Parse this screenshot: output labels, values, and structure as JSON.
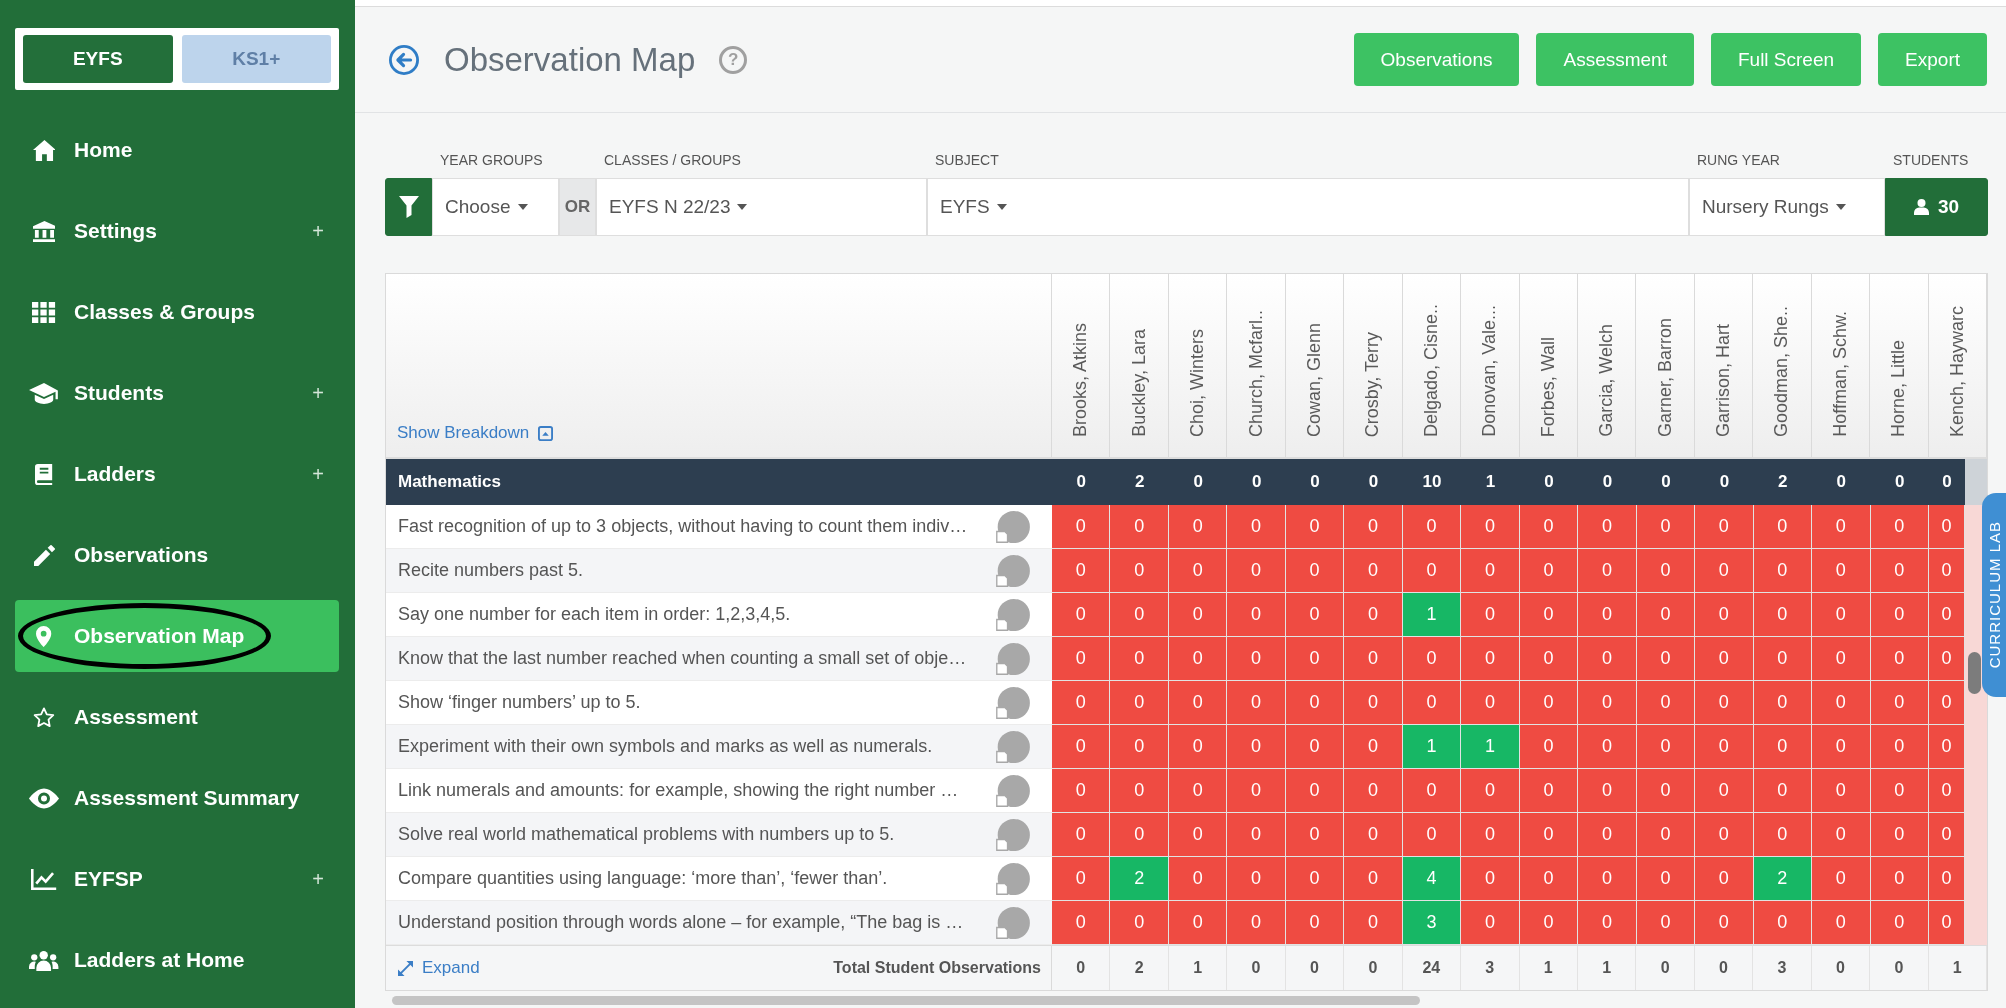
{
  "sidebar": {
    "modes": [
      {
        "label": "EYFS",
        "selected": true
      },
      {
        "label": "KS1+",
        "selected": false
      }
    ],
    "items": [
      {
        "label": "Home",
        "selected": false,
        "circled": false
      },
      {
        "label": "Settings",
        "expander": "+",
        "selected": false,
        "circled": false
      },
      {
        "label": "Classes & Groups",
        "selected": false,
        "circled": false
      },
      {
        "label": "Students",
        "expander": "+",
        "selected": false,
        "circled": false
      },
      {
        "label": "Ladders",
        "expander": "+",
        "selected": false,
        "circled": false
      },
      {
        "label": "Observations",
        "selected": false,
        "circled": false
      },
      {
        "label": "Observation Map",
        "selected": true,
        "circled": true
      },
      {
        "label": "Assessment",
        "selected": false,
        "circled": false
      },
      {
        "label": "Assessment Summary",
        "selected": false,
        "circled": false
      },
      {
        "label": "EYFSP",
        "expander": "+",
        "selected": false,
        "circled": false
      },
      {
        "label": "Ladders at Home",
        "selected": false,
        "circled": false
      }
    ]
  },
  "header": {
    "title": "Observation Map",
    "help": "?",
    "buttons": [
      "Observations",
      "Assessment",
      "Full Screen",
      "Export"
    ]
  },
  "filters": {
    "year_groups": {
      "label": "YEAR GROUPS",
      "value": "Choose"
    },
    "separator": "OR",
    "classes_groups": {
      "label": "CLASSES / GROUPS",
      "value": "EYFS N 22/23"
    },
    "subject": {
      "label": "SUBJECT",
      "value": "EYFS"
    },
    "rung_year": {
      "label": "RUNG YEAR",
      "value": "Nursery Rungs"
    },
    "students": {
      "label": "STUDENTS",
      "count": "30"
    }
  },
  "observation_map": {
    "show_breakdown": "Show Breakdown",
    "students": [
      "Brooks, Atkins",
      "Buckley, Lara",
      "Choi, Winters",
      "Church, Mcfarl..",
      "Cowan, Glenn",
      "Crosby, Terry",
      "Delgado, Cisne..",
      "Donovan, Vale...",
      "Forbes, Wall",
      "Garcia, Welch",
      "Garner, Barron",
      "Garrison, Hart",
      "Goodman, She..",
      "Hoffman, Schw.",
      "Horne, Little",
      "Kench, Haywarc"
    ],
    "section": {
      "name": "Mathematics",
      "totals": [
        "0",
        "2",
        "0",
        "0",
        "0",
        "0",
        "10",
        "1",
        "0",
        "0",
        "0",
        "0",
        "2",
        "0",
        "0",
        "0"
      ]
    },
    "rows": [
      {
        "text": "Fast recognition of up to 3 objects, without having to count them indiv…",
        "cells": [
          {
            "count": "0",
            "observed": false
          },
          {
            "count": "0",
            "observed": false
          },
          {
            "count": "0",
            "observed": false
          },
          {
            "count": "0",
            "observed": false
          },
          {
            "count": "0",
            "observed": false
          },
          {
            "count": "0",
            "observed": false
          },
          {
            "count": "0",
            "observed": false
          },
          {
            "count": "0",
            "observed": false
          },
          {
            "count": "0",
            "observed": false
          },
          {
            "count": "0",
            "observed": false
          },
          {
            "count": "0",
            "observed": false
          },
          {
            "count": "0",
            "observed": false
          },
          {
            "count": "0",
            "observed": false
          },
          {
            "count": "0",
            "observed": false
          },
          {
            "count": "0",
            "observed": false
          },
          {
            "count": "0",
            "observed": false
          }
        ]
      },
      {
        "text": "Recite numbers past 5.",
        "cells": [
          {
            "count": "0",
            "observed": false
          },
          {
            "count": "0",
            "observed": false
          },
          {
            "count": "0",
            "observed": false
          },
          {
            "count": "0",
            "observed": false
          },
          {
            "count": "0",
            "observed": false
          },
          {
            "count": "0",
            "observed": false
          },
          {
            "count": "0",
            "observed": false
          },
          {
            "count": "0",
            "observed": false
          },
          {
            "count": "0",
            "observed": false
          },
          {
            "count": "0",
            "observed": false
          },
          {
            "count": "0",
            "observed": false
          },
          {
            "count": "0",
            "observed": false
          },
          {
            "count": "0",
            "observed": false
          },
          {
            "count": "0",
            "observed": false
          },
          {
            "count": "0",
            "observed": false
          },
          {
            "count": "0",
            "observed": false
          }
        ]
      },
      {
        "text": "Say one number for each item in order: 1,2,3,4,5.",
        "cells": [
          {
            "count": "0",
            "observed": false
          },
          {
            "count": "0",
            "observed": false
          },
          {
            "count": "0",
            "observed": false
          },
          {
            "count": "0",
            "observed": false
          },
          {
            "count": "0",
            "observed": false
          },
          {
            "count": "0",
            "observed": false
          },
          {
            "count": "1",
            "observed": true
          },
          {
            "count": "0",
            "observed": false
          },
          {
            "count": "0",
            "observed": false
          },
          {
            "count": "0",
            "observed": false
          },
          {
            "count": "0",
            "observed": false
          },
          {
            "count": "0",
            "observed": false
          },
          {
            "count": "0",
            "observed": false
          },
          {
            "count": "0",
            "observed": false
          },
          {
            "count": "0",
            "observed": false
          },
          {
            "count": "0",
            "observed": false
          }
        ]
      },
      {
        "text": "Know that the last number reached when counting a small set of obje…",
        "cells": [
          {
            "count": "0",
            "observed": false
          },
          {
            "count": "0",
            "observed": false
          },
          {
            "count": "0",
            "observed": false
          },
          {
            "count": "0",
            "observed": false
          },
          {
            "count": "0",
            "observed": false
          },
          {
            "count": "0",
            "observed": false
          },
          {
            "count": "0",
            "observed": false
          },
          {
            "count": "0",
            "observed": false
          },
          {
            "count": "0",
            "observed": false
          },
          {
            "count": "0",
            "observed": false
          },
          {
            "count": "0",
            "observed": false
          },
          {
            "count": "0",
            "observed": false
          },
          {
            "count": "0",
            "observed": false
          },
          {
            "count": "0",
            "observed": false
          },
          {
            "count": "0",
            "observed": false
          },
          {
            "count": "0",
            "observed": false
          }
        ]
      },
      {
        "text": "Show ‘finger numbers’ up to 5.",
        "cells": [
          {
            "count": "0",
            "observed": false
          },
          {
            "count": "0",
            "observed": false
          },
          {
            "count": "0",
            "observed": false
          },
          {
            "count": "0",
            "observed": false
          },
          {
            "count": "0",
            "observed": false
          },
          {
            "count": "0",
            "observed": false
          },
          {
            "count": "0",
            "observed": false
          },
          {
            "count": "0",
            "observed": false
          },
          {
            "count": "0",
            "observed": false
          },
          {
            "count": "0",
            "observed": false
          },
          {
            "count": "0",
            "observed": false
          },
          {
            "count": "0",
            "observed": false
          },
          {
            "count": "0",
            "observed": false
          },
          {
            "count": "0",
            "observed": false
          },
          {
            "count": "0",
            "observed": false
          },
          {
            "count": "0",
            "observed": false
          }
        ]
      },
      {
        "text": "Experiment with their own symbols and marks as well as numerals.",
        "cells": [
          {
            "count": "0",
            "observed": false
          },
          {
            "count": "0",
            "observed": false
          },
          {
            "count": "0",
            "observed": false
          },
          {
            "count": "0",
            "observed": false
          },
          {
            "count": "0",
            "observed": false
          },
          {
            "count": "0",
            "observed": false
          },
          {
            "count": "1",
            "observed": true
          },
          {
            "count": "1",
            "observed": true
          },
          {
            "count": "0",
            "observed": false
          },
          {
            "count": "0",
            "observed": false
          },
          {
            "count": "0",
            "observed": false
          },
          {
            "count": "0",
            "observed": false
          },
          {
            "count": "0",
            "observed": false
          },
          {
            "count": "0",
            "observed": false
          },
          {
            "count": "0",
            "observed": false
          },
          {
            "count": "0",
            "observed": false
          }
        ]
      },
      {
        "text": "Link numerals and amounts: for example, showing the right number …",
        "cells": [
          {
            "count": "0",
            "observed": false
          },
          {
            "count": "0",
            "observed": false
          },
          {
            "count": "0",
            "observed": false
          },
          {
            "count": "0",
            "observed": false
          },
          {
            "count": "0",
            "observed": false
          },
          {
            "count": "0",
            "observed": false
          },
          {
            "count": "0",
            "observed": false
          },
          {
            "count": "0",
            "observed": false
          },
          {
            "count": "0",
            "observed": false
          },
          {
            "count": "0",
            "observed": false
          },
          {
            "count": "0",
            "observed": false
          },
          {
            "count": "0",
            "observed": false
          },
          {
            "count": "0",
            "observed": false
          },
          {
            "count": "0",
            "observed": false
          },
          {
            "count": "0",
            "observed": false
          },
          {
            "count": "0",
            "observed": false
          }
        ]
      },
      {
        "text": "Solve real world mathematical problems with numbers up to 5.",
        "cells": [
          {
            "count": "0",
            "observed": false
          },
          {
            "count": "0",
            "observed": false
          },
          {
            "count": "0",
            "observed": false
          },
          {
            "count": "0",
            "observed": false
          },
          {
            "count": "0",
            "observed": false
          },
          {
            "count": "0",
            "observed": false
          },
          {
            "count": "0",
            "observed": false
          },
          {
            "count": "0",
            "observed": false
          },
          {
            "count": "0",
            "observed": false
          },
          {
            "count": "0",
            "observed": false
          },
          {
            "count": "0",
            "observed": false
          },
          {
            "count": "0",
            "observed": false
          },
          {
            "count": "0",
            "observed": false
          },
          {
            "count": "0",
            "observed": false
          },
          {
            "count": "0",
            "observed": false
          },
          {
            "count": "0",
            "observed": false
          }
        ]
      },
      {
        "text": "Compare quantities using language: ‘more than’, ‘fewer than’.",
        "cells": [
          {
            "count": "0",
            "observed": false
          },
          {
            "count": "2",
            "observed": true
          },
          {
            "count": "0",
            "observed": false
          },
          {
            "count": "0",
            "observed": false
          },
          {
            "count": "0",
            "observed": false
          },
          {
            "count": "0",
            "observed": false
          },
          {
            "count": "4",
            "observed": true
          },
          {
            "count": "0",
            "observed": false
          },
          {
            "count": "0",
            "observed": false
          },
          {
            "count": "0",
            "observed": false
          },
          {
            "count": "0",
            "observed": false
          },
          {
            "count": "0",
            "observed": false
          },
          {
            "count": "2",
            "observed": true
          },
          {
            "count": "0",
            "observed": false
          },
          {
            "count": "0",
            "observed": false
          },
          {
            "count": "0",
            "observed": false
          }
        ]
      },
      {
        "text": "Understand position through words alone – for example, “The bag is …",
        "cells": [
          {
            "count": "0",
            "observed": false
          },
          {
            "count": "0",
            "observed": false
          },
          {
            "count": "0",
            "observed": false
          },
          {
            "count": "0",
            "observed": false
          },
          {
            "count": "0",
            "observed": false
          },
          {
            "count": "0",
            "observed": false
          },
          {
            "count": "3",
            "observed": true
          },
          {
            "count": "0",
            "observed": false
          },
          {
            "count": "0",
            "observed": false
          },
          {
            "count": "0",
            "observed": false
          },
          {
            "count": "0",
            "observed": false
          },
          {
            "count": "0",
            "observed": false
          },
          {
            "count": "0",
            "observed": false
          },
          {
            "count": "0",
            "observed": false
          },
          {
            "count": "0",
            "observed": false
          },
          {
            "count": "0",
            "observed": false
          }
        ]
      }
    ],
    "footer": {
      "expand": "Expand",
      "total_label": "Total Student Observations",
      "totals": [
        "0",
        "2",
        "1",
        "0",
        "0",
        "0",
        "24",
        "3",
        "1",
        "1",
        "0",
        "0",
        "3",
        "0",
        "0",
        "1"
      ]
    }
  },
  "side_tab": {
    "label": "CURRICULUM LAB"
  }
}
